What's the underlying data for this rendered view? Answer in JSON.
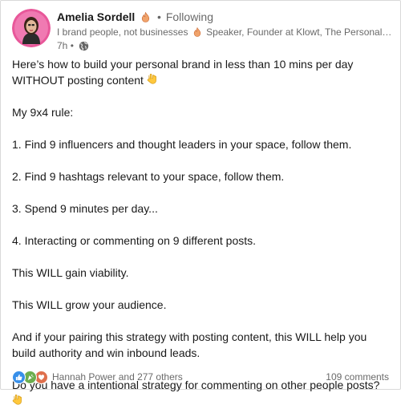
{
  "author": {
    "name": "Amelia Sordell",
    "following_label": "Following",
    "headline_part1": "I brand people, not businesses",
    "headline_part2": "Speaker, Founder at Klowt, The Personal Brand...",
    "time": "7h"
  },
  "post": {
    "intro": "Here’s how to build your personal brand in less than 10 mins per day WITHOUT posting content",
    "rule_title": "My 9x4 rule:",
    "step1": "1. Find 9 influencers and thought leaders in your space, follow them.",
    "step2": "2. Find 9 hashtags relevant to your space, follow them.",
    "step3": "3. Spend 9 minutes per day...",
    "step4": "4. Interacting or commenting on 9 different posts.",
    "line_viability": "This WILL gain viability.",
    "line_audience": "This WILL grow your audience.",
    "closing": "And if your pairing this strategy with posting content, this WILL help you build authority and win inbound leads.",
    "question": "Do you have a intentional strategy for commenting on other people posts?"
  },
  "footer": {
    "reactions_text": "Hannah Power and 277 others",
    "comments_text": "109 comments"
  },
  "icons": {
    "flame": "fire-icon",
    "pointer": "backhand-index-pointing-down-icon",
    "globe": "globe-icon"
  },
  "colors": {
    "like": "#378fe9",
    "celebrate": "#6dae4f",
    "love": "#df704d",
    "avatar_bg": "#e8589a"
  }
}
